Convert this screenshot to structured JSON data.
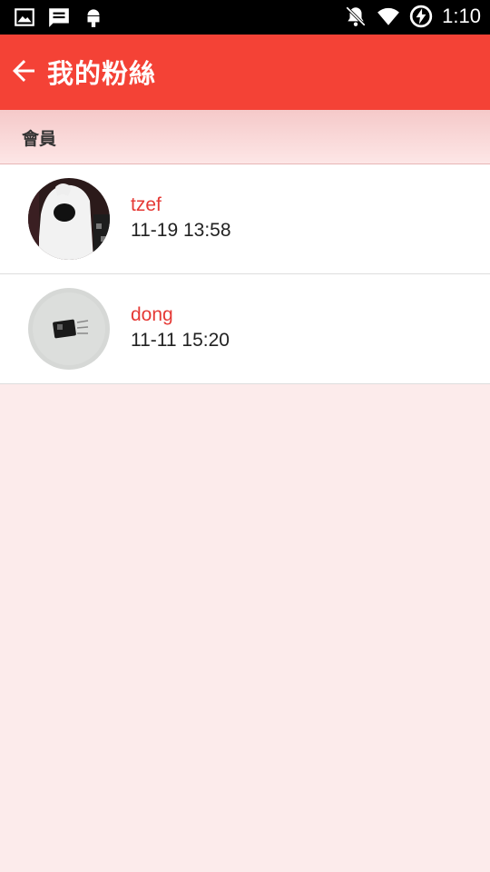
{
  "status_bar": {
    "time": "1:10",
    "icons": [
      "image-icon",
      "message-icon",
      "android-icon",
      "muted-bell-icon",
      "wifi-icon",
      "battery-charging-icon"
    ]
  },
  "app_bar": {
    "title": "我的粉絲",
    "back_icon": "arrow-back-icon",
    "color": "#f44236"
  },
  "section": {
    "label": "會員"
  },
  "followers": [
    {
      "name": "tzef",
      "time": "11-19 13:58"
    },
    {
      "name": "dong",
      "time": "11-11 15:20"
    }
  ],
  "colors": {
    "accent": "#f44236",
    "name_text": "#e53935",
    "background": "#fcebeb"
  }
}
